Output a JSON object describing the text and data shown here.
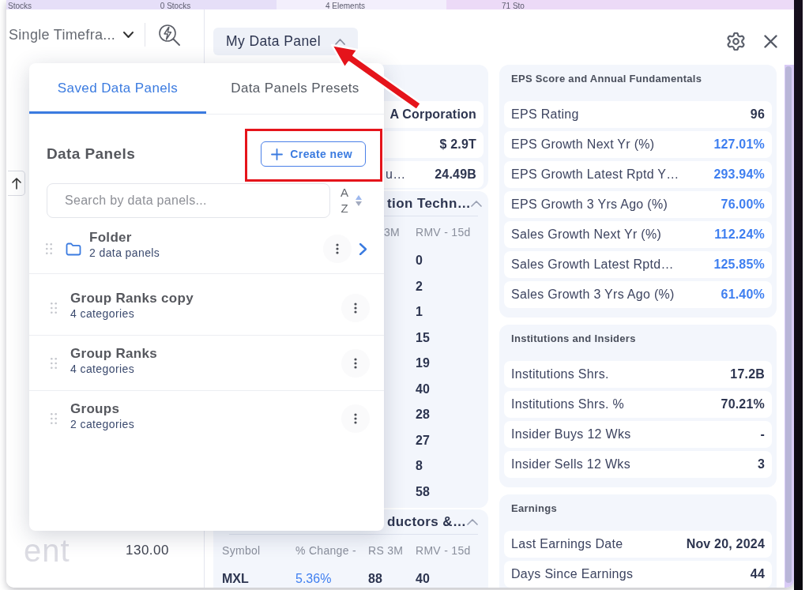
{
  "summary_strip": [
    {
      "label": "Stocks"
    },
    {
      "label": "0 Stocks"
    },
    {
      "label": "4 Elements"
    },
    {
      "label": "71 Sto"
    }
  ],
  "background_app": {
    "timeframe": "Single Timefra...",
    "faded_text": "ent",
    "price": "130.00"
  },
  "data_panel": {
    "title": "My Data Panel",
    "menu_open": true,
    "summary_rows": [
      {
        "value": "A Corporation"
      },
      {
        "value": "$ 2.9T"
      },
      {
        "label": "u…",
        "value": "24.49B"
      }
    ],
    "sections": [
      {
        "title": "tion Techn…",
        "expanded": true,
        "columns": {
          "rs": "3M",
          "rmv": "RMV - 15d"
        },
        "rows": [
          {
            "rmv": "0"
          },
          {
            "rmv": "2"
          },
          {
            "rmv": "1"
          },
          {
            "rmv": "15"
          },
          {
            "rmv": "19"
          },
          {
            "rmv": "40"
          },
          {
            "rmv": "28"
          },
          {
            "rmv": "27"
          },
          {
            "rmv": "8"
          },
          {
            "rmv": "58"
          }
        ]
      },
      {
        "title": "ductors &…",
        "expanded": true,
        "columns": {
          "symbol": "Symbol",
          "change": "% Change -",
          "rs": "RS 3M",
          "rmv": "RMV - 15d"
        },
        "rows": [
          {
            "symbol": "MXL",
            "change": "5.36%",
            "rs": "88",
            "rmv": "40"
          }
        ]
      }
    ],
    "cards": [
      {
        "title": "EPS Score and Annual Fundamentals",
        "rows": [
          {
            "label": "EPS Rating",
            "value": "96",
            "accent": false
          },
          {
            "label": "EPS Growth Next Yr (%)",
            "value": "127.01%",
            "accent": true
          },
          {
            "label": "EPS Growth Latest Rptd Y…",
            "value": "293.94%",
            "accent": true
          },
          {
            "label": "EPS Growth 3 Yrs Ago (%)",
            "value": "76.00%",
            "accent": true
          },
          {
            "label": "Sales Growth Next Yr (%)",
            "value": "112.24%",
            "accent": true
          },
          {
            "label": "Sales Growth Latest Rptd…",
            "value": "125.85%",
            "accent": true
          },
          {
            "label": "Sales Growth 3 Yrs Ago (%)",
            "value": "61.40%",
            "accent": true
          }
        ]
      },
      {
        "title": "Institutions and Insiders",
        "rows": [
          {
            "label": "Institutions Shrs.",
            "value": "17.2B",
            "accent": false
          },
          {
            "label": "Institutions Shrs. %",
            "value": "70.21%",
            "accent": false
          },
          {
            "label": "Insider Buys 12 Wks",
            "value": "-",
            "accent": false
          },
          {
            "label": "Insider Sells 12 Wks",
            "value": "3",
            "accent": false
          }
        ]
      },
      {
        "title": "Earnings",
        "rows": [
          {
            "label": "Last Earnings Date",
            "value": "Nov 20, 2024",
            "accent": false
          },
          {
            "label": "Days Since Earnings",
            "value": "44",
            "accent": false
          }
        ]
      }
    ]
  },
  "panel_menu": {
    "tabs": [
      {
        "label": "Saved Data Panels",
        "selected": true
      },
      {
        "label": "Data Panels Presets",
        "selected": false
      }
    ],
    "heading": "Data Panels",
    "create_button": "Create new",
    "search": {
      "placeholder": "Search by data panels..."
    },
    "sort": {
      "top": "A",
      "bottom": "Z"
    },
    "items": [
      {
        "kind": "folder",
        "title": "Folder",
        "subtitle": "2 data panels"
      },
      {
        "kind": "panel",
        "title": "Group Ranks copy",
        "subtitle": "4 categories"
      },
      {
        "kind": "panel",
        "title": "Group Ranks",
        "subtitle": "4 categories"
      },
      {
        "kind": "panel",
        "title": "Groups",
        "subtitle": "2 categories"
      }
    ]
  }
}
